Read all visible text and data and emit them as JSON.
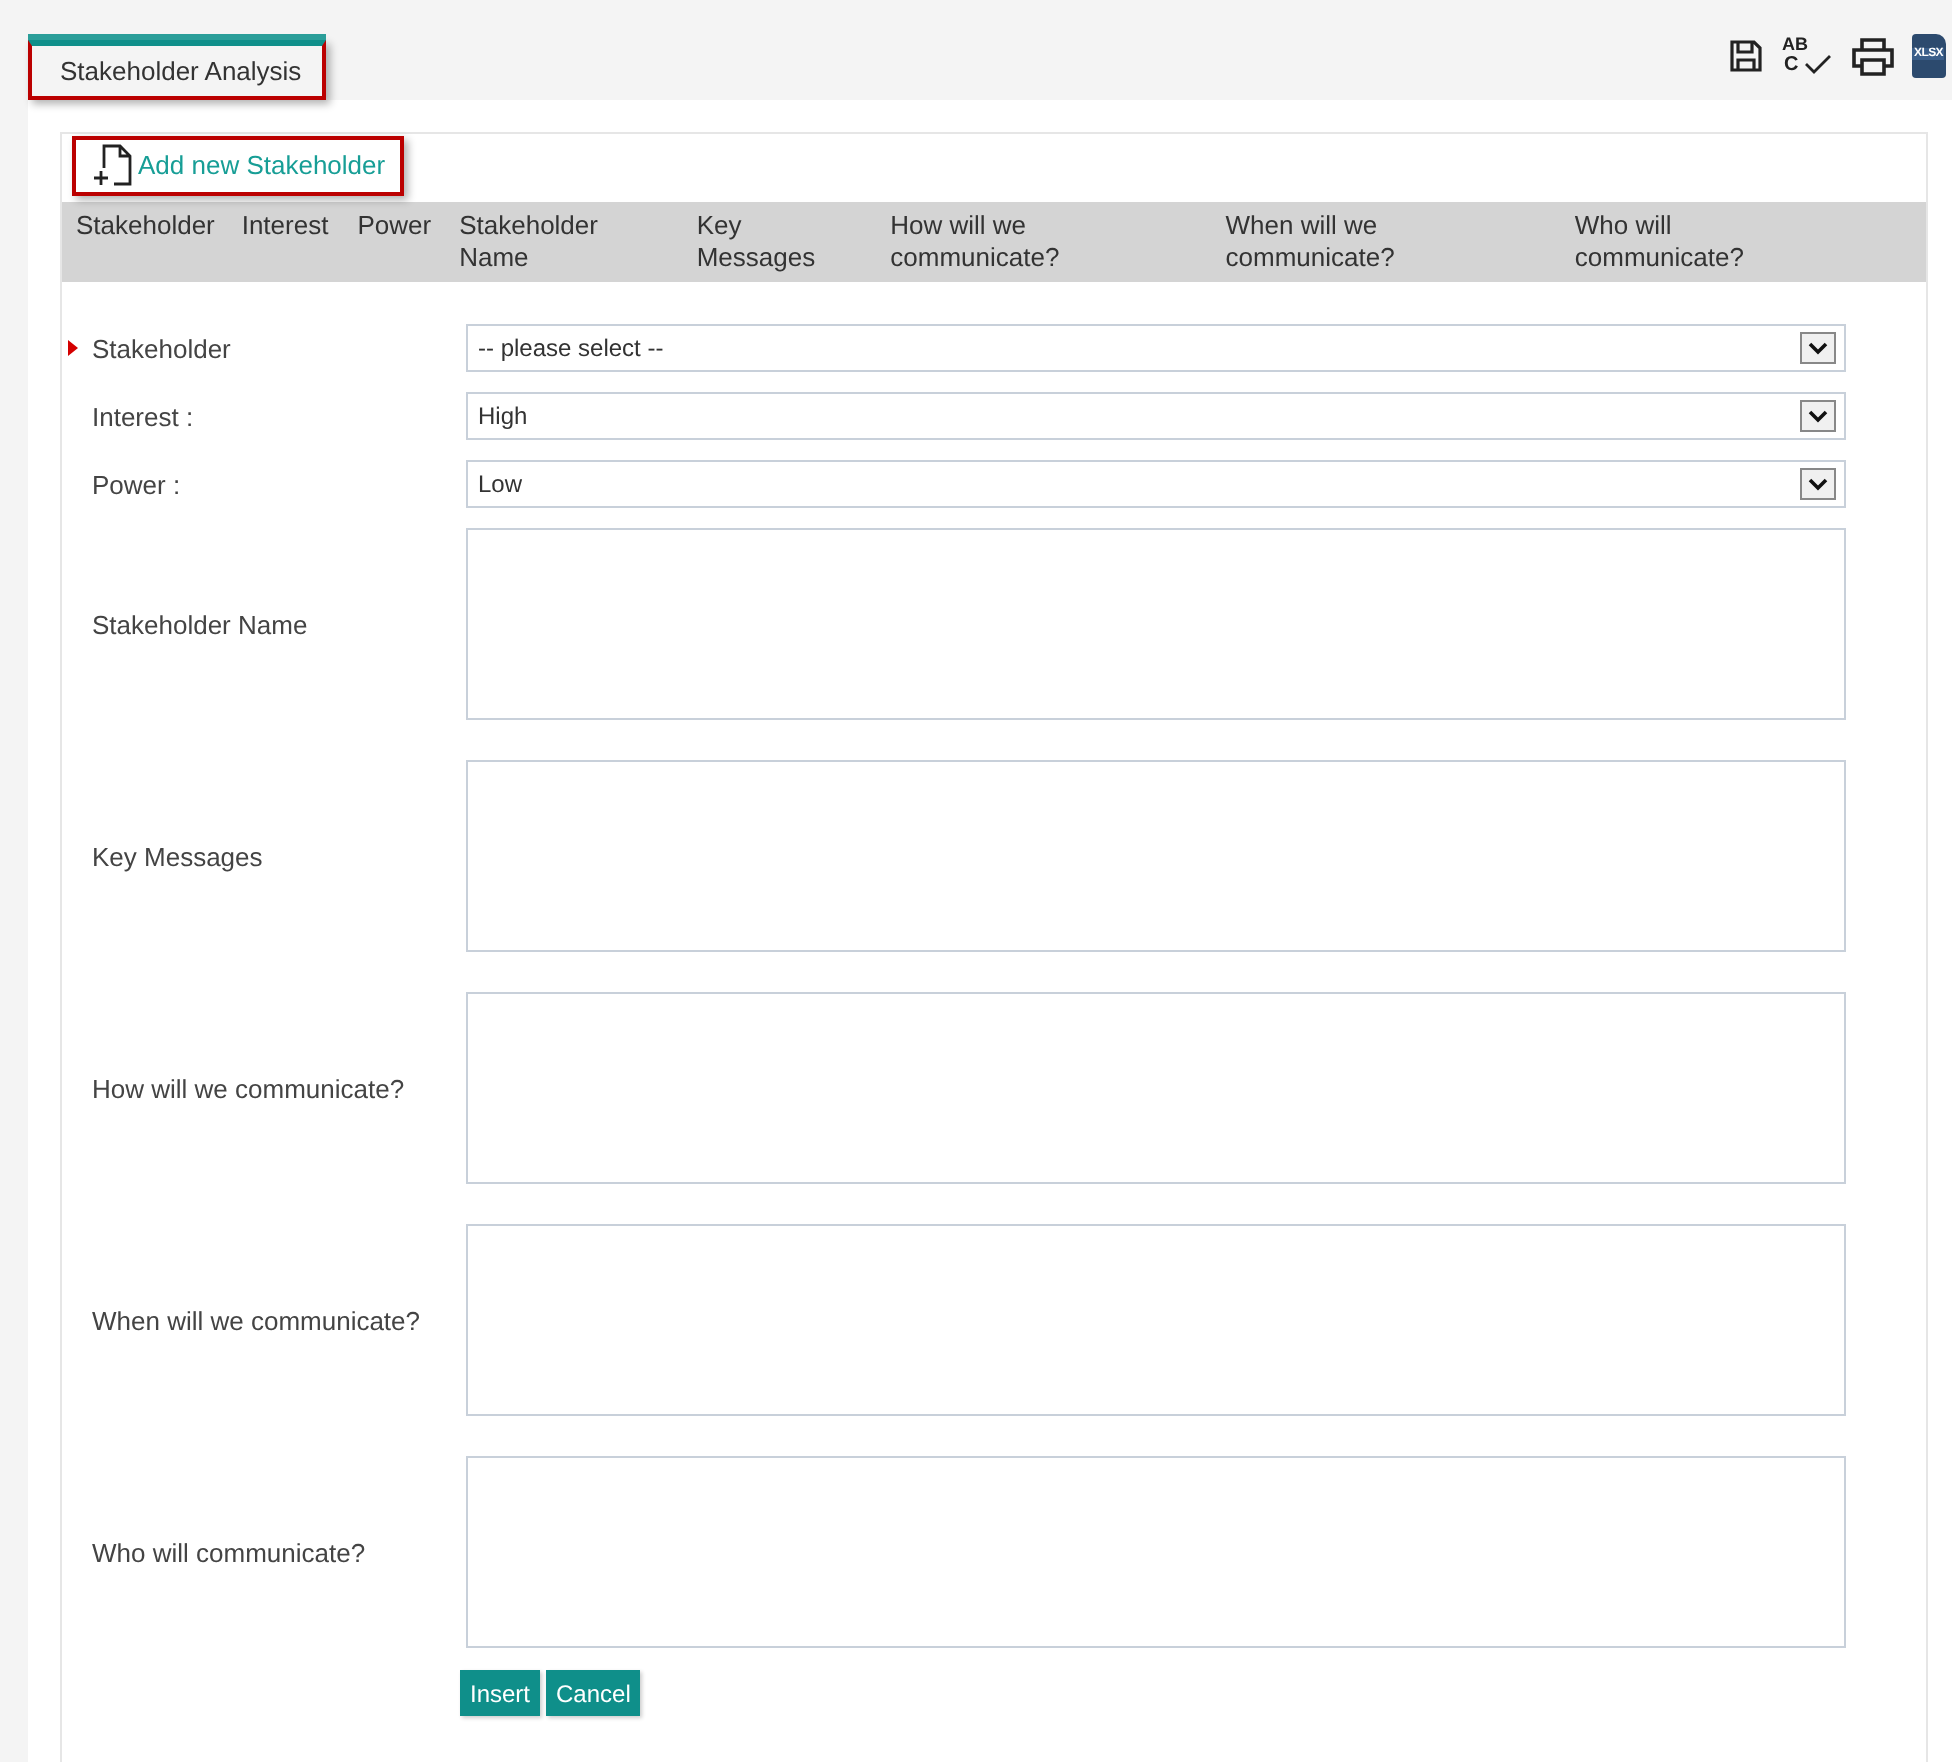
{
  "tab": {
    "label": "Stakeholder Analysis",
    "selected": true
  },
  "toolbar": [
    {
      "kind": "save"
    },
    {
      "kind": "spellcheck",
      "label_top": "AB",
      "label_bottom": "C"
    },
    {
      "kind": "print"
    },
    {
      "kind": "export",
      "label": "XLSX"
    }
  ],
  "add_link": "Add new Stakeholder",
  "table": {
    "columns": [
      {
        "label": "Stakeholder"
      },
      {
        "label": "Interest"
      },
      {
        "label": "Power"
      },
      {
        "label": "Stakeholder Name"
      },
      {
        "label": "Key Messages"
      },
      {
        "label": "How will we communicate?"
      },
      {
        "label": "When will we communicate?"
      },
      {
        "label": "Who will communicate?"
      }
    ]
  },
  "form": [
    {
      "kind": "select",
      "label": "Stakeholder",
      "value": "-- please select --",
      "required": true
    },
    {
      "kind": "select",
      "label": "Interest :",
      "value": "High",
      "required": false
    },
    {
      "kind": "select",
      "label": "Power :",
      "value": "Low",
      "required": false
    },
    {
      "kind": "textarea",
      "label": "Stakeholder Name",
      "required": false
    },
    {
      "kind": "textarea",
      "label": "Key Messages",
      "required": false
    },
    {
      "kind": "textarea",
      "label": "How will we communicate?",
      "required": false
    },
    {
      "kind": "textarea",
      "label": "When will we communicate?",
      "required": false
    },
    {
      "kind": "textarea",
      "label": "Who will communicate?",
      "required": false
    }
  ],
  "buttons": [
    "Insert",
    "Cancel"
  ]
}
